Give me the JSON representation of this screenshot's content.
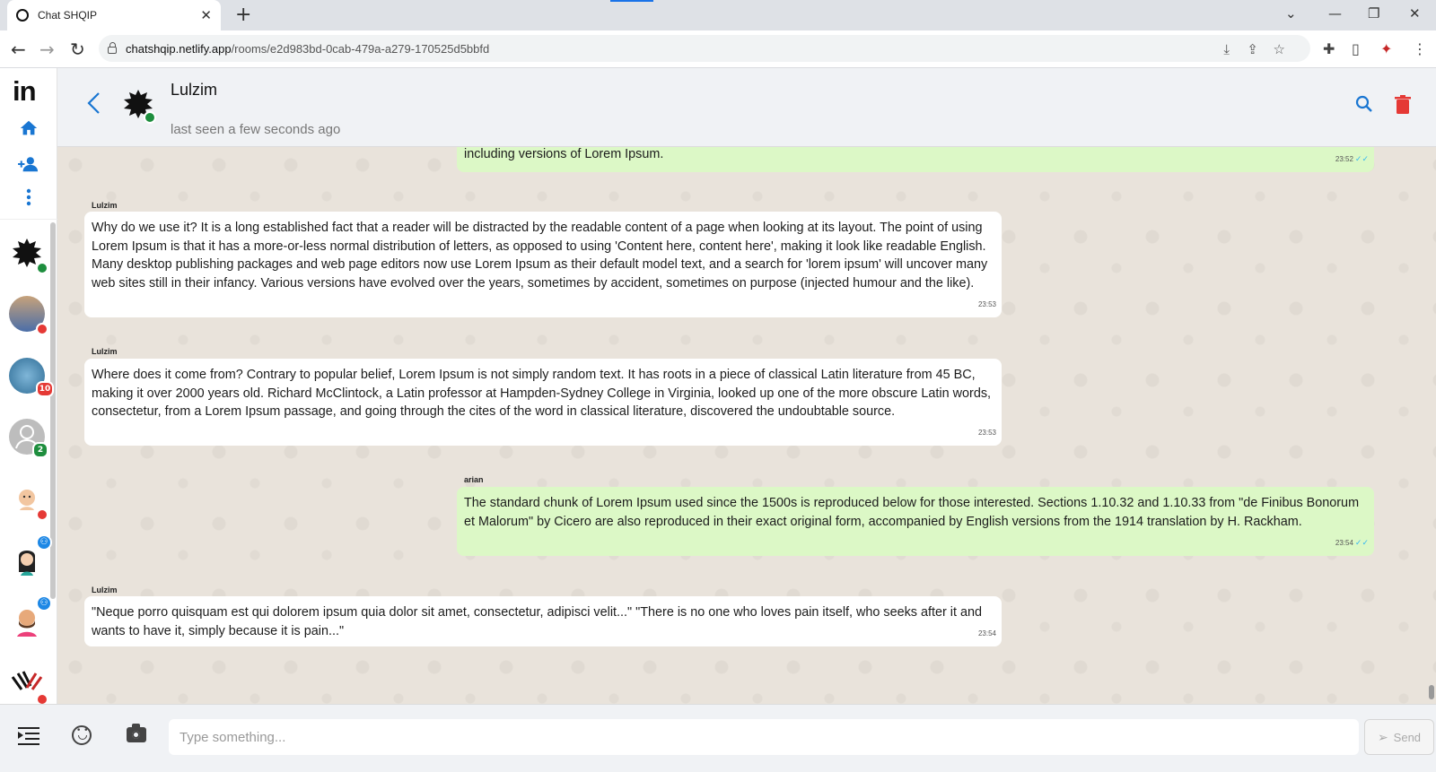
{
  "browser": {
    "tab_title": "Chat SHQIP",
    "url_host": "chatshqip.netlify.app",
    "url_path": "/rooms/e2d983bd-0cab-479a-a279-170525d5bbfd"
  },
  "sidebar": {
    "logo": "in",
    "contacts": [
      {
        "status": "online"
      },
      {
        "status": "offline"
      },
      {
        "badge": "10"
      },
      {
        "badge": "2"
      },
      {
        "status": "offline"
      },
      {
        "status": "group"
      },
      {
        "status": "group"
      },
      {
        "status": "offline"
      }
    ]
  },
  "header": {
    "name": "Lulzim",
    "last_seen": "last seen a few seconds ago"
  },
  "messages": [
    {
      "direction": "out",
      "text": "including versions of Lorem Ipsum.",
      "time": "23:52"
    },
    {
      "direction": "in",
      "sender": "Lulzim",
      "text": "Why do we use it? It is a long established fact that a reader will be distracted by the readable content of a page when looking at its layout. The point of using Lorem Ipsum is that it has a more-or-less normal distribution of letters, as opposed to using 'Content here, content here', making it look like readable English. Many desktop publishing packages and web page editors now use Lorem Ipsum as their default model text, and a search for 'lorem ipsum' will uncover many web sites still in their infancy. Various versions have evolved over the years, sometimes by accident, sometimes on purpose (injected humour and the like).",
      "time": "23:53"
    },
    {
      "direction": "in",
      "sender": "Lulzim",
      "text": "Where does it come from? Contrary to popular belief, Lorem Ipsum is not simply random text. It has roots in a piece of classical Latin literature from 45 BC, making it over 2000 years old. Richard McClintock, a Latin professor at Hampden-Sydney College in Virginia, looked up one of the more obscure Latin words, consectetur, from a Lorem Ipsum passage, and going through the cites of the word in classical literature, discovered the undoubtable source.",
      "time": "23:53"
    },
    {
      "direction": "out",
      "sender": "arian",
      "text": "The standard chunk of Lorem Ipsum used since the 1500s is reproduced below for those interested. Sections 1.10.32 and 1.10.33 from \"de Finibus Bonorum et Malorum\" by Cicero are also reproduced in their exact original form, accompanied by English versions from the 1914 translation by H. Rackham.",
      "time": "23:54"
    },
    {
      "direction": "in",
      "sender": "Lulzim",
      "text": "\"Neque porro quisquam est qui dolorem ipsum quia dolor sit amet, consectetur, adipisci velit...\" \"There is no one who loves pain itself, who seeks after it and wants to have it, simply because it is pain...\"",
      "time": "23:54"
    }
  ],
  "composer": {
    "placeholder": "Type something...",
    "send_label": "Send"
  },
  "colors": {
    "accent": "#1976d2",
    "outgoing_bubble": "#dcf8c6",
    "incoming_bubble": "#ffffff",
    "chat_background": "#e9e3db",
    "delete": "#e53935"
  }
}
